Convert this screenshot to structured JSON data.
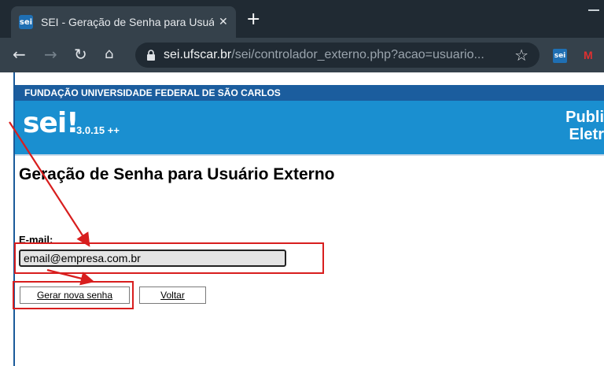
{
  "browser": {
    "tab_title": "SEI - Geração de Senha para Usuá",
    "favicon_text": "sei",
    "url_host": "sei.ufscar.br",
    "url_path": "/sei/controlador_externo.php?acao=usuario...",
    "extension_sei": "sei",
    "extension_m": "M"
  },
  "header": {
    "org_name": "FUNDAÇÃO UNIVERSIDADE FEDERAL DE SÃO CARLOS",
    "logo_text": "sei!",
    "version": "3.0.15 ++",
    "right_line1": "Publi",
    "right_line2": "Eletr"
  },
  "form": {
    "title": "Geração de Senha para Usuário Externo",
    "email_label": "E-mail:",
    "email_value": "email@empresa.com.br",
    "submit_label": "Gerar nova senha",
    "back_label": "Voltar"
  },
  "colors": {
    "annotation": "#d81e1e",
    "header_blue": "#1a8fd0",
    "org_bar": "#1b5d9e"
  }
}
